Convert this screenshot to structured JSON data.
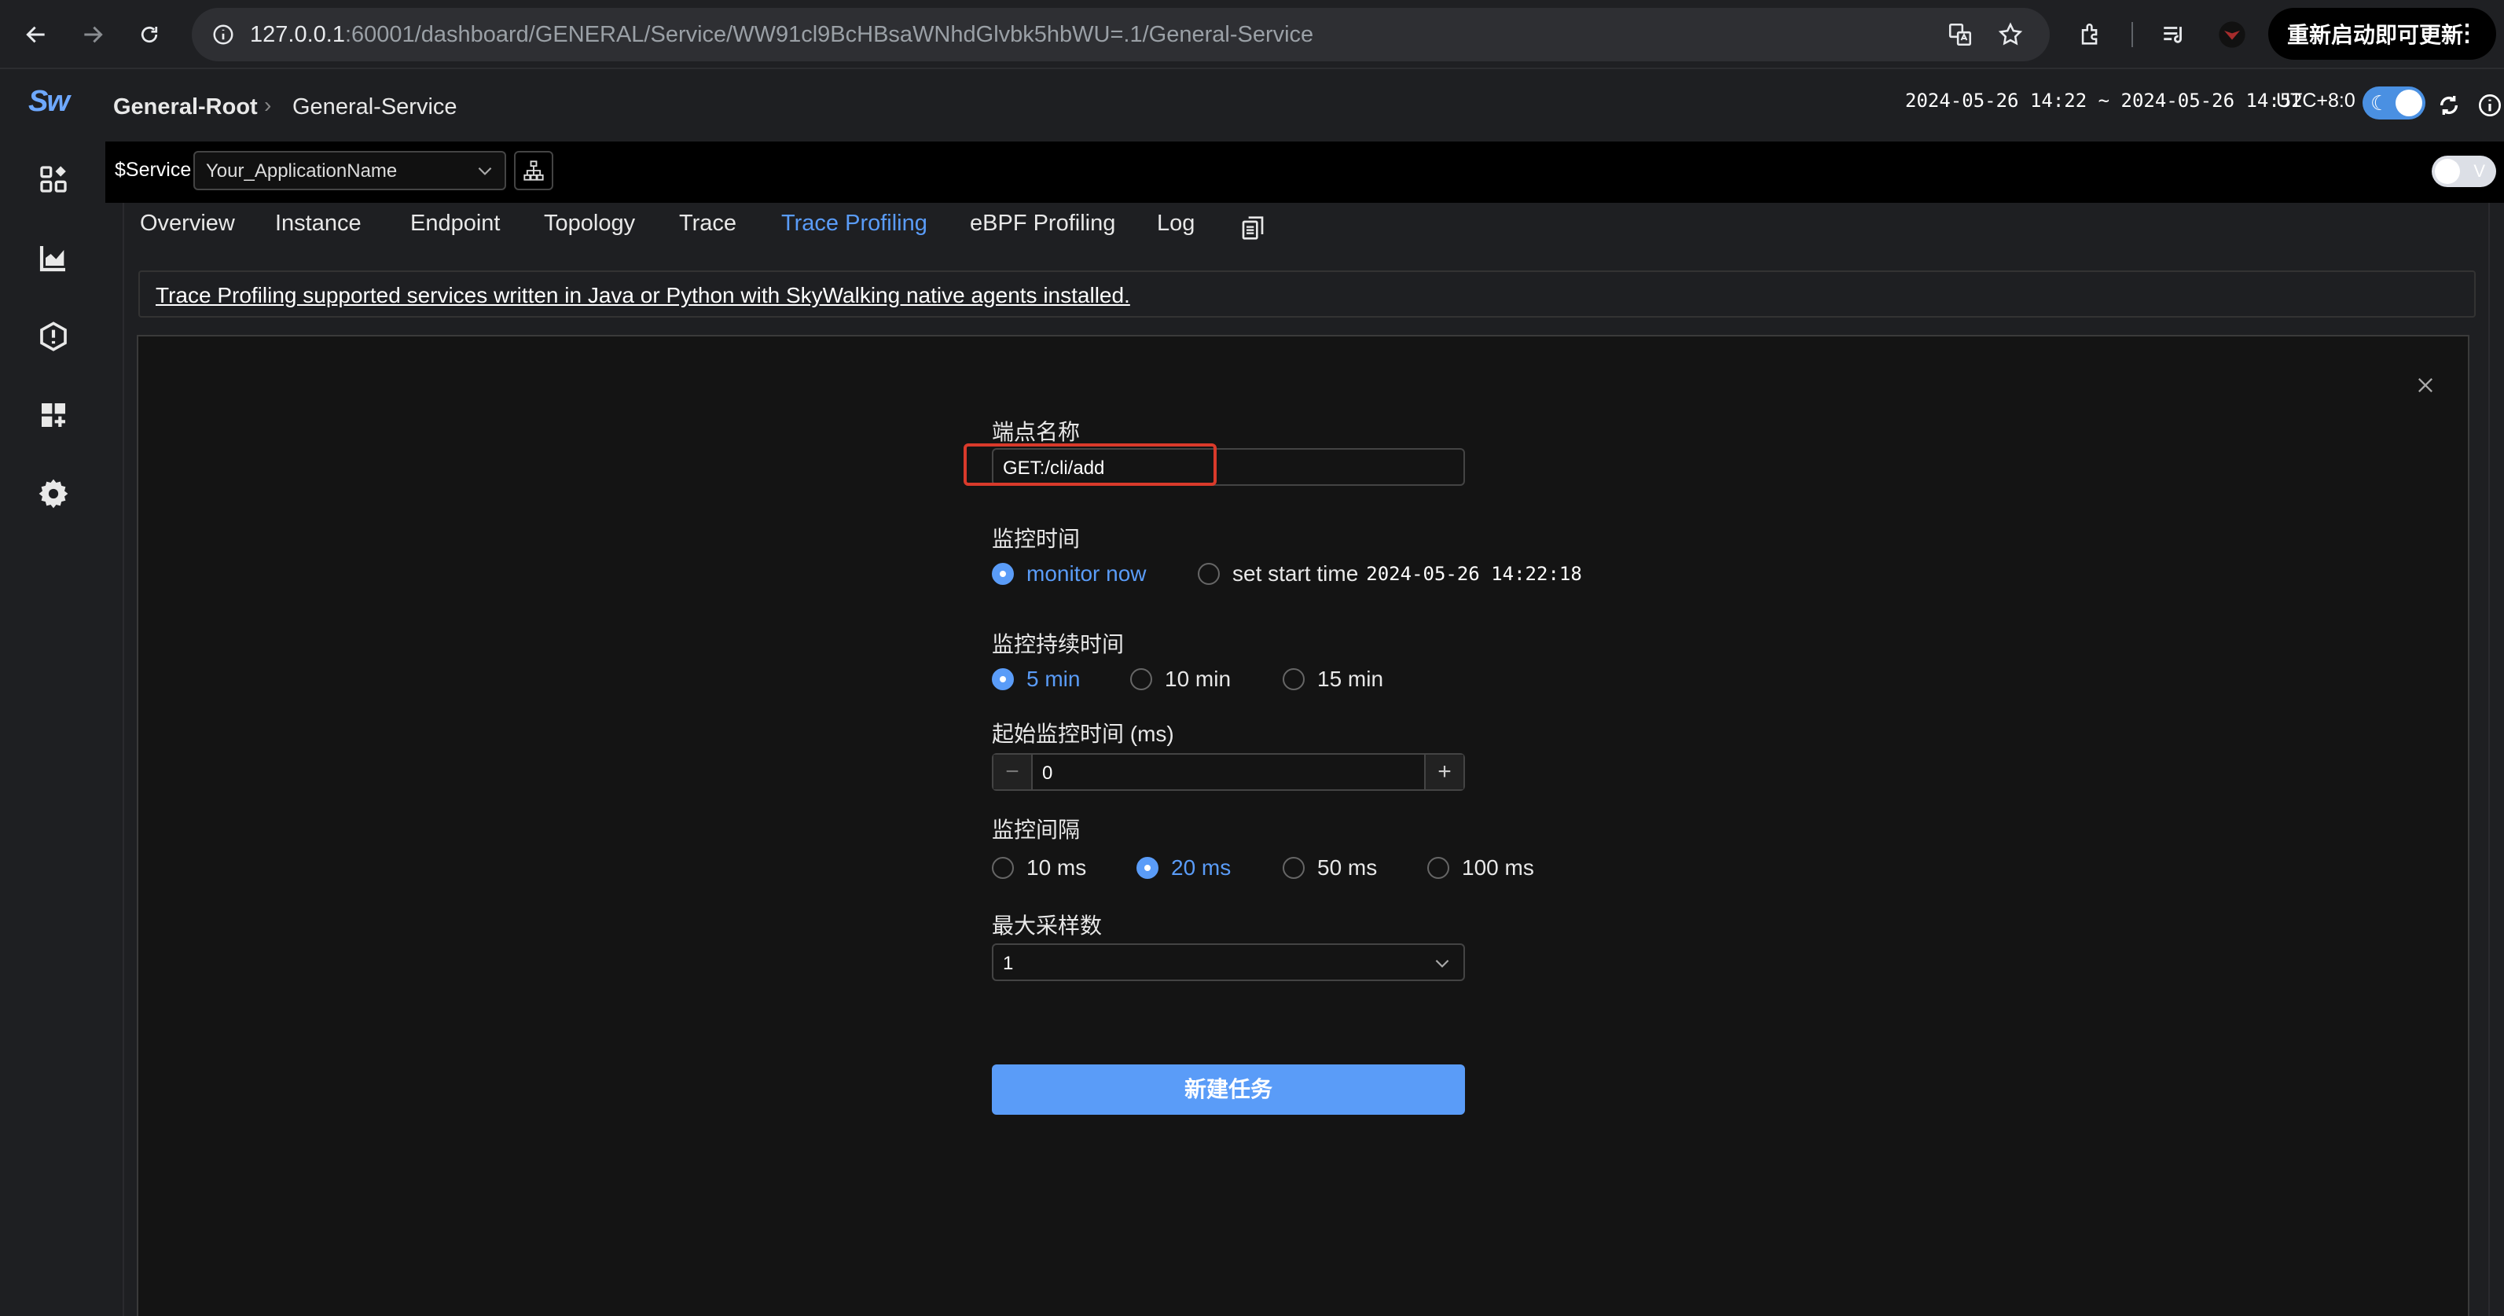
{
  "browser": {
    "url_host": "127.0.0.1",
    "url_rest": ":60001/dashboard/GENERAL/Service/WW91cl9BcHBsaWNhdGlvbk5hbWU=.1/General-Service",
    "relaunch_label": "重新启动即可更新"
  },
  "sidebar": {
    "logo": "Sw",
    "icons": [
      "dashboard-icon",
      "chart-icon",
      "alert-icon",
      "add-widget-icon",
      "settings-icon"
    ]
  },
  "header": {
    "breadcrumb_root": "General-Root",
    "breadcrumb_service": "General-Service",
    "time_range": "2024-05-26 14:22 ~ 2024-05-26 14:52",
    "timezone": "UTC+8:0"
  },
  "selector": {
    "label": "$Service",
    "value": "Your_ApplicationName",
    "toggle_label": "V"
  },
  "tabs": [
    {
      "label": "Overview"
    },
    {
      "label": "Instance"
    },
    {
      "label": "Endpoint"
    },
    {
      "label": "Topology"
    },
    {
      "label": "Trace"
    },
    {
      "label": "Trace Profiling",
      "active": true
    },
    {
      "label": "eBPF Profiling"
    },
    {
      "label": "Log"
    }
  ],
  "notice": "Trace Profiling supported services written in Java or Python with SkyWalking native agents installed.",
  "form": {
    "endpoint_label": "端点名称",
    "endpoint_value": "GET:/cli/add",
    "monitor_time_label": "监控时间",
    "monitor_now": "monitor now",
    "set_start_time": "set start time",
    "start_time_value": "2024-05-26 14:22:18",
    "duration_label": "监控持续时间",
    "duration_options": [
      "5 min",
      "10 min",
      "15 min"
    ],
    "duration_selected": "5 min",
    "start_offset_label": "起始监控时间 (ms)",
    "start_offset_value": "0",
    "interval_label": "监控间隔",
    "interval_options": [
      "10 ms",
      "20 ms",
      "50 ms",
      "100 ms"
    ],
    "interval_selected": "20 ms",
    "max_samples_label": "最大采样数",
    "max_samples_value": "1",
    "submit_label": "新建任务"
  },
  "colors": {
    "accent": "#5a9cf8",
    "highlight": "#d93a2b",
    "background": "#141414"
  }
}
